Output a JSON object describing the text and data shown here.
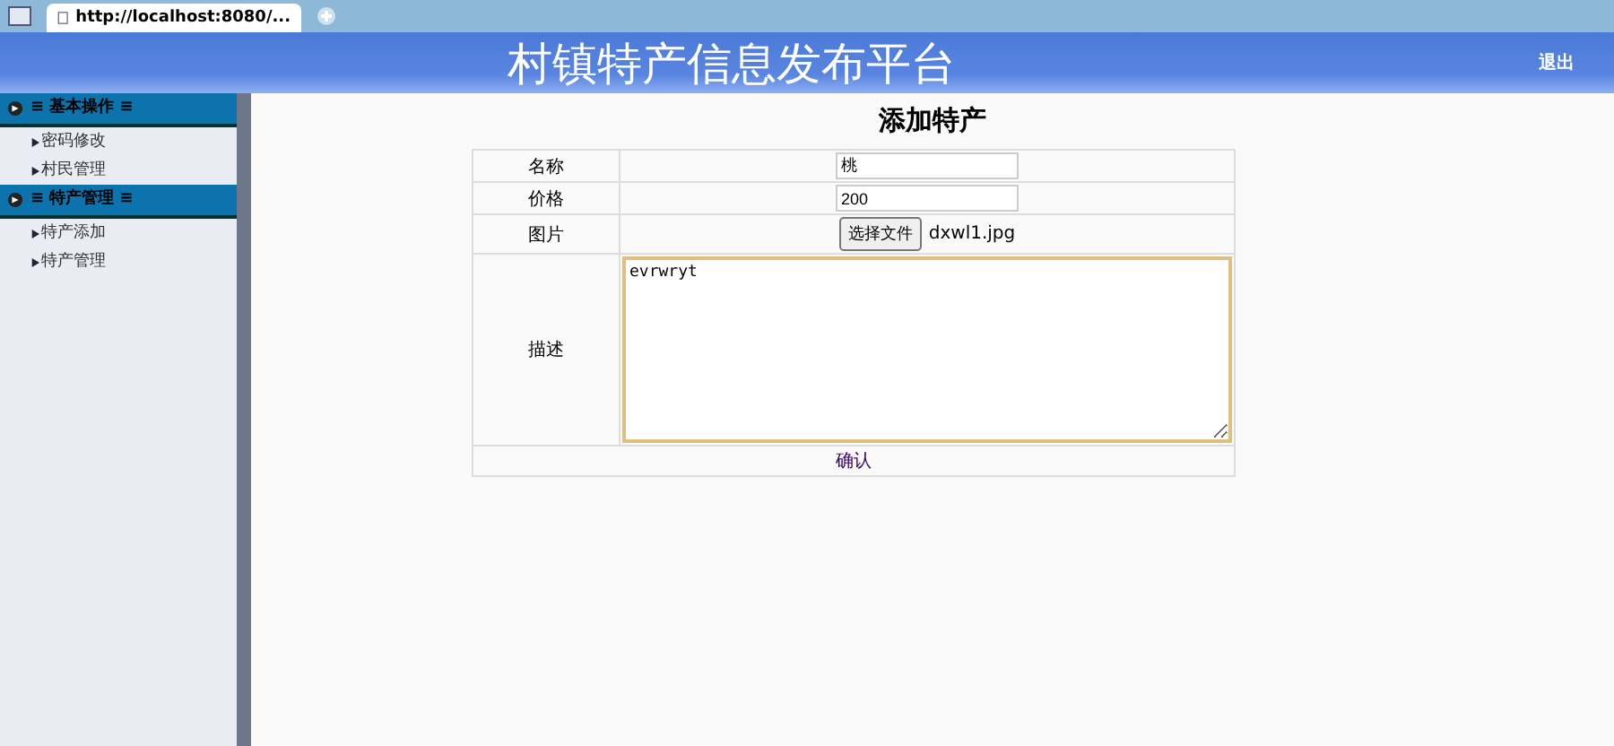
{
  "browser": {
    "tab_title": "http://localhost:8080/..."
  },
  "header": {
    "title": "村镇特产信息发布平台",
    "logout": "退出"
  },
  "sidebar": {
    "groups": [
      {
        "title": "≡ 基本操作 ≡",
        "expanded": true,
        "items": [
          {
            "label": "密码修改"
          },
          {
            "label": "村民管理"
          }
        ]
      },
      {
        "title": "≡ 特产管理 ≡",
        "expanded": true,
        "items": [
          {
            "label": "特产添加"
          },
          {
            "label": "特产管理"
          }
        ]
      }
    ]
  },
  "form": {
    "title": "添加特产",
    "rows": [
      {
        "kind": "text",
        "label": "名称",
        "value": "桃"
      },
      {
        "kind": "text",
        "label": "价格",
        "value": "200"
      },
      {
        "kind": "file",
        "label": "图片",
        "button": "选择文件",
        "value": "dxwl1.jpg"
      },
      {
        "kind": "textarea",
        "label": "描述",
        "value": "evrwryt"
      }
    ],
    "submit": "确认"
  }
}
